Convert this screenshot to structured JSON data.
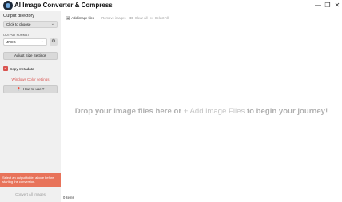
{
  "window": {
    "title": "AI Image Converter & Compress",
    "minimize_glyph": "—",
    "maximize_glyph": "❐",
    "close_glyph": "✕"
  },
  "sidebar": {
    "output_directory_label": "Output directory",
    "output_directory_value": "Click to choose",
    "output_format_label": "OUTPUT FORMAT",
    "output_format_value": "JPEG",
    "adjust_size_label": "Adjust Size Settings",
    "copy_metadata_label": "Copy metadata",
    "copy_metadata_checked": true,
    "windows_color_link": "Windows Color settings",
    "how_to_use_label": "How to use ?",
    "status_warning": "Select an output folder above before starting the conversion.",
    "convert_all_label": "Convert All Images"
  },
  "toolbar": {
    "add_label": "Add image files",
    "remove_label": "Remove images",
    "clear_label": "Clear All",
    "select_label": "Select All"
  },
  "main": {
    "drop_prefix": "Drop your image files here or",
    "drop_link": "+ Add image Files",
    "drop_suffix": "to begin your journey!"
  },
  "footer": {
    "items_count": "0 items"
  },
  "colors": {
    "accent": "#d9534f",
    "warning_bg": "#e8735a",
    "sidebar_bg": "#f0f0f0"
  },
  "icons": {
    "logo": "aperture-logo-icon",
    "add": "add-image-icon",
    "remove": "remove-icon",
    "clear": "clear-icon",
    "select": "select-all-icon",
    "pin": "pin-icon",
    "settings": "gear-icon"
  }
}
